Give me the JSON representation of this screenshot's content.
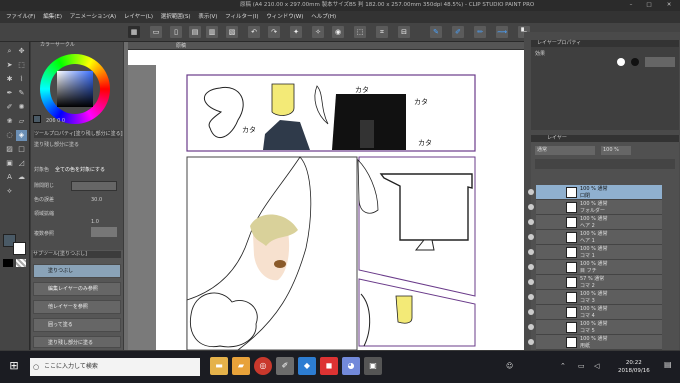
{
  "window": {
    "title": "原稿 (A4 210.00 x 297.00mm 製本サイズB5 判 182.00 x 257.00mm 350dpi 48.5%) - CLIP STUDIO PAINT PRO",
    "min": "–",
    "max": "□",
    "close": "✕"
  },
  "menu": [
    "ファイル(F)",
    "編集(E)",
    "アニメーション(A)",
    "レイヤー(L)",
    "選択範囲(S)",
    "表示(V)",
    "フィルター(I)",
    "ウィンドウ(W)",
    "ヘルプ(H)"
  ],
  "canvas_tab": "原稿",
  "color_panel": {
    "label": "カラーサークル",
    "hsv": "206 0 0"
  },
  "subtool_panel": {
    "label": "ツールプロパティ[塗り残し部分に塗る]",
    "tool_name": "塗り残し部分に塗る",
    "target": "対象色",
    "target_value": "全ての色を対象にする",
    "close_gap": "隙間閉じ",
    "color_margin": "色の誤差",
    "color_margin_value": "30.0",
    "area_scaling": "領域拡縮",
    "area_value": "1.0",
    "antialias": "アンチエイリアス",
    "reference": "複数参照"
  },
  "fill_panel": {
    "label": "サブツール[塗りつぶし]",
    "items": [
      "塗りつぶし",
      "編集レイヤーのみ参照",
      "他レイヤーを参照",
      "囲って塗る",
      "塗り残し部分に塗る"
    ],
    "selected": 4
  },
  "manga": {
    "sfx": [
      "カタ",
      "カタ",
      "カタ",
      "カタ"
    ]
  },
  "nav_panel": {
    "label": "レイヤープロパティ",
    "effect": "効果"
  },
  "layer_panel": {
    "label": "レイヤー",
    "blend": "通常",
    "opacity": "100 %",
    "layers": [
      {
        "name": "100 % 通常",
        "sub": "口閉",
        "indent": 0
      },
      {
        "name": "100 % 通常",
        "sub": "フォルダー",
        "indent": 1
      },
      {
        "name": "100 % 通常",
        "sub": "ヘア 2",
        "indent": 2
      },
      {
        "name": "100 % 通常",
        "sub": "ヘア 1",
        "indent": 2
      },
      {
        "name": "100 % 通常",
        "sub": "コマ 1",
        "indent": 2
      },
      {
        "name": "100 % 通常",
        "sub": "目 フチ",
        "indent": 1
      },
      {
        "name": "57 % 通常",
        "sub": "コマ 2",
        "indent": 1
      },
      {
        "name": "100 % 通常",
        "sub": "コマ 3",
        "indent": 2
      },
      {
        "name": "100 % 通常",
        "sub": "コマ 4",
        "indent": 2
      },
      {
        "name": "100 % 通常",
        "sub": "コマ 5",
        "indent": 2
      },
      {
        "name": "100 % 通常",
        "sub": "用紙",
        "indent": 0
      }
    ],
    "selected": 0
  },
  "taskbar": {
    "search": "ここに入力して検索",
    "time": "20:22",
    "date": "2018/09/16"
  }
}
